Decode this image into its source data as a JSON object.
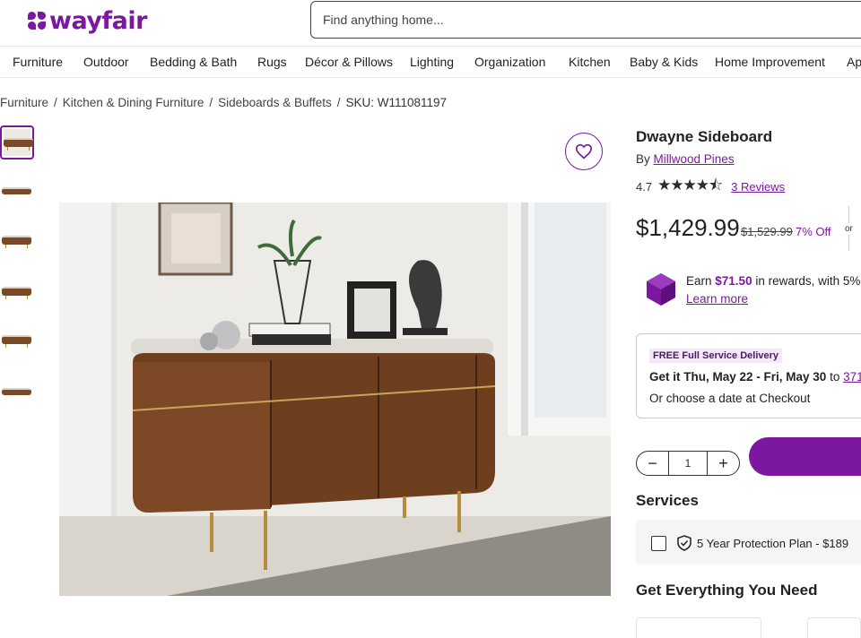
{
  "brand": {
    "logo_text": "wayfair",
    "color": "#7b189f"
  },
  "search": {
    "placeholder": "Find anything home..."
  },
  "nav": [
    "Furniture",
    "Outdoor",
    "Bedding & Bath",
    "Rugs",
    "Décor & Pillows",
    "Lighting",
    "Organization",
    "Kitchen",
    "Baby & Kids",
    "Home Improvement",
    "Ap"
  ],
  "breadcrumb": {
    "items": [
      "Furniture",
      "Kitchen & Dining Furniture",
      "Sideboards & Buffets"
    ],
    "separator": "/",
    "sku": "SKU: W111081197"
  },
  "product": {
    "title": "Dwayne Sideboard",
    "by_label": "By",
    "brand": "Millwood Pines",
    "rating": "4.7",
    "stars": "★★★★⯪",
    "reviews": "3 Reviews",
    "price": "$1,429.99",
    "old_price": "$1,529.99",
    "discount": "7% Off",
    "or_text": "or"
  },
  "rewards": {
    "prefix": "Earn ",
    "amount": "$71.50",
    "suffix": " in rewards, with 5%",
    "learn_more": "Learn more"
  },
  "delivery": {
    "tag": "FREE Full Service Delivery",
    "date_prefix": "Get it ",
    "date_range": "Thu, May 22 - Fri, May 30",
    "to_label": " to ",
    "zip": "371",
    "alt": "Or choose a date at Checkout"
  },
  "quantity": {
    "value": "1",
    "minus": "−",
    "plus": "+"
  },
  "services": {
    "title": "Services",
    "plan": "5 Year Protection Plan - $189"
  },
  "everything": {
    "title": "Get Everything You Need"
  },
  "icons": {
    "favorite": "heart-icon",
    "rewards": "gem-icon",
    "protection": "shield-check-icon"
  }
}
